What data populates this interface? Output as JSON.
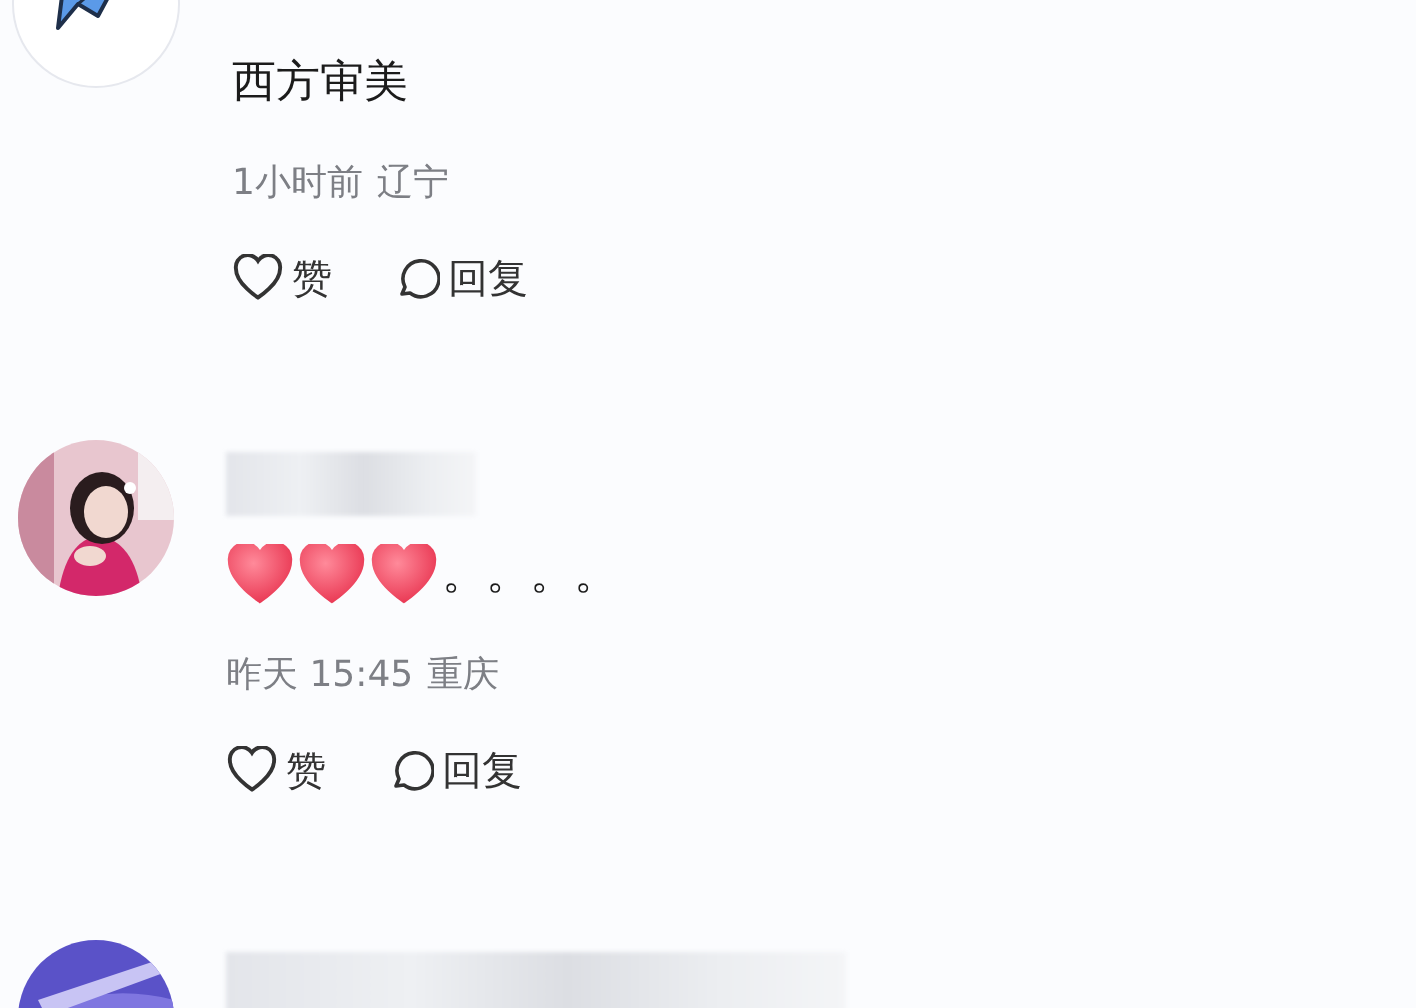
{
  "comments": [
    {
      "avatar": {
        "kind": "plane"
      },
      "username_blurred": false,
      "content": [
        {
          "kind": "text",
          "text": "西方审美"
        }
      ],
      "time": "1小时前",
      "location": "辽宁",
      "actions": [
        {
          "kind": "like",
          "label": "赞"
        },
        {
          "kind": "reply",
          "label": "回复"
        }
      ]
    },
    {
      "avatar": {
        "kind": "picture"
      },
      "username_blurred": true,
      "content": [
        {
          "kind": "heart"
        },
        {
          "kind": "heart"
        },
        {
          "kind": "heart"
        },
        {
          "kind": "text",
          "text": "。。。。"
        }
      ],
      "time": "昨天 15:45",
      "location": "重庆",
      "actions": [
        {
          "kind": "like",
          "label": "赞"
        },
        {
          "kind": "reply",
          "label": "回复"
        }
      ]
    },
    {
      "avatar": {
        "kind": "picture"
      },
      "username_blurred": true
    }
  ]
}
